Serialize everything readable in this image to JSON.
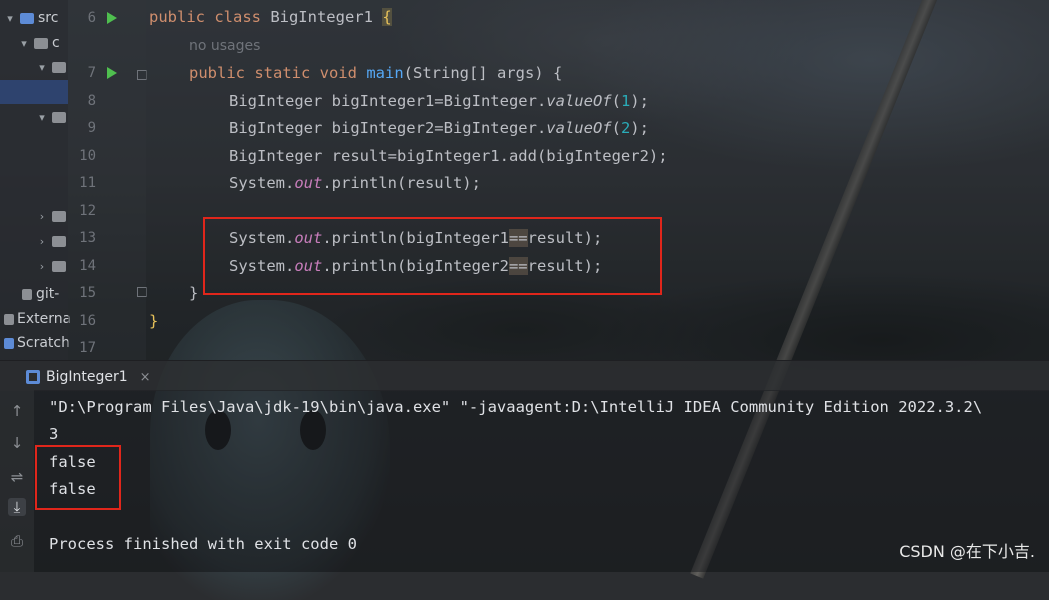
{
  "project_tree": {
    "items": [
      {
        "label": "src",
        "chevron": "▾"
      },
      {
        "label": "c",
        "chevron": "▾"
      },
      {
        "label": "",
        "chevron": "▾"
      },
      {
        "label": "",
        "chevron": "▾"
      },
      {
        "label": "",
        "chevron": "›"
      },
      {
        "label": "",
        "chevron": "›"
      },
      {
        "label": "",
        "chevron": "›"
      },
      {
        "label": "git-",
        "chevron": ""
      },
      {
        "label": "Externa",
        "chevron": ""
      },
      {
        "label": "Scratch",
        "chevron": ""
      }
    ]
  },
  "gutter": {
    "line_numbers": [
      "6",
      "",
      "7",
      "8",
      "9",
      "10",
      "11",
      "12",
      "13",
      "14",
      "15",
      "16",
      "17"
    ]
  },
  "code": {
    "line6_kw": "public class",
    "line6_name": " BigInteger1 ",
    "line6_brace": "{",
    "hint": "no usages",
    "line7_kw": "public static void",
    "line7_fn": "main",
    "line7_rest": "(String[] args) {",
    "line8_a": "BigInteger bigInteger1=BigInteger.",
    "line8_m": "valueOf",
    "line8_p1": "(",
    "line8_n": "1",
    "line8_p2": ");",
    "line9_a": "BigInteger bigInteger2=BigInteger.",
    "line9_m": "valueOf",
    "line9_p1": "(",
    "line9_n": "2",
    "line9_p2": ");",
    "line10": "BigInteger result=bigInteger1.add(bigInteger2);",
    "line11_a": "System.",
    "line11_out": "out",
    "line11_b": ".println(result);",
    "line13_a": "System.",
    "line13_out": "out",
    "line13_b": ".println(bigInteger1",
    "line13_op": "==",
    "line13_c": "result);",
    "line14_a": "System.",
    "line14_out": "out",
    "line14_b": ".println(bigInteger2",
    "line14_op": "==",
    "line14_c": "result);",
    "line15": "}",
    "line16": "}"
  },
  "run_panel": {
    "tab_label": "BigInteger1",
    "close": "×",
    "tools": [
      "↑",
      "↓",
      "⇌",
      "⤓",
      "⎙",
      "🗑"
    ],
    "output": [
      "\"D:\\Program Files\\Java\\jdk-19\\bin\\java.exe\" \"-javaagent:D:\\IntelliJ IDEA Community Edition 2022.3.2\\",
      "3",
      "false",
      "false",
      "",
      "Process finished with exit code 0"
    ]
  },
  "watermark": "CSDN @在下小吉.",
  "colors": {
    "keyword": "#cf8e6d",
    "method": "#56a8f5",
    "number": "#2aacb8",
    "static_field": "#c77dbb",
    "highlight_box": "#e0261b",
    "run_icon": "#4fbf4f"
  }
}
